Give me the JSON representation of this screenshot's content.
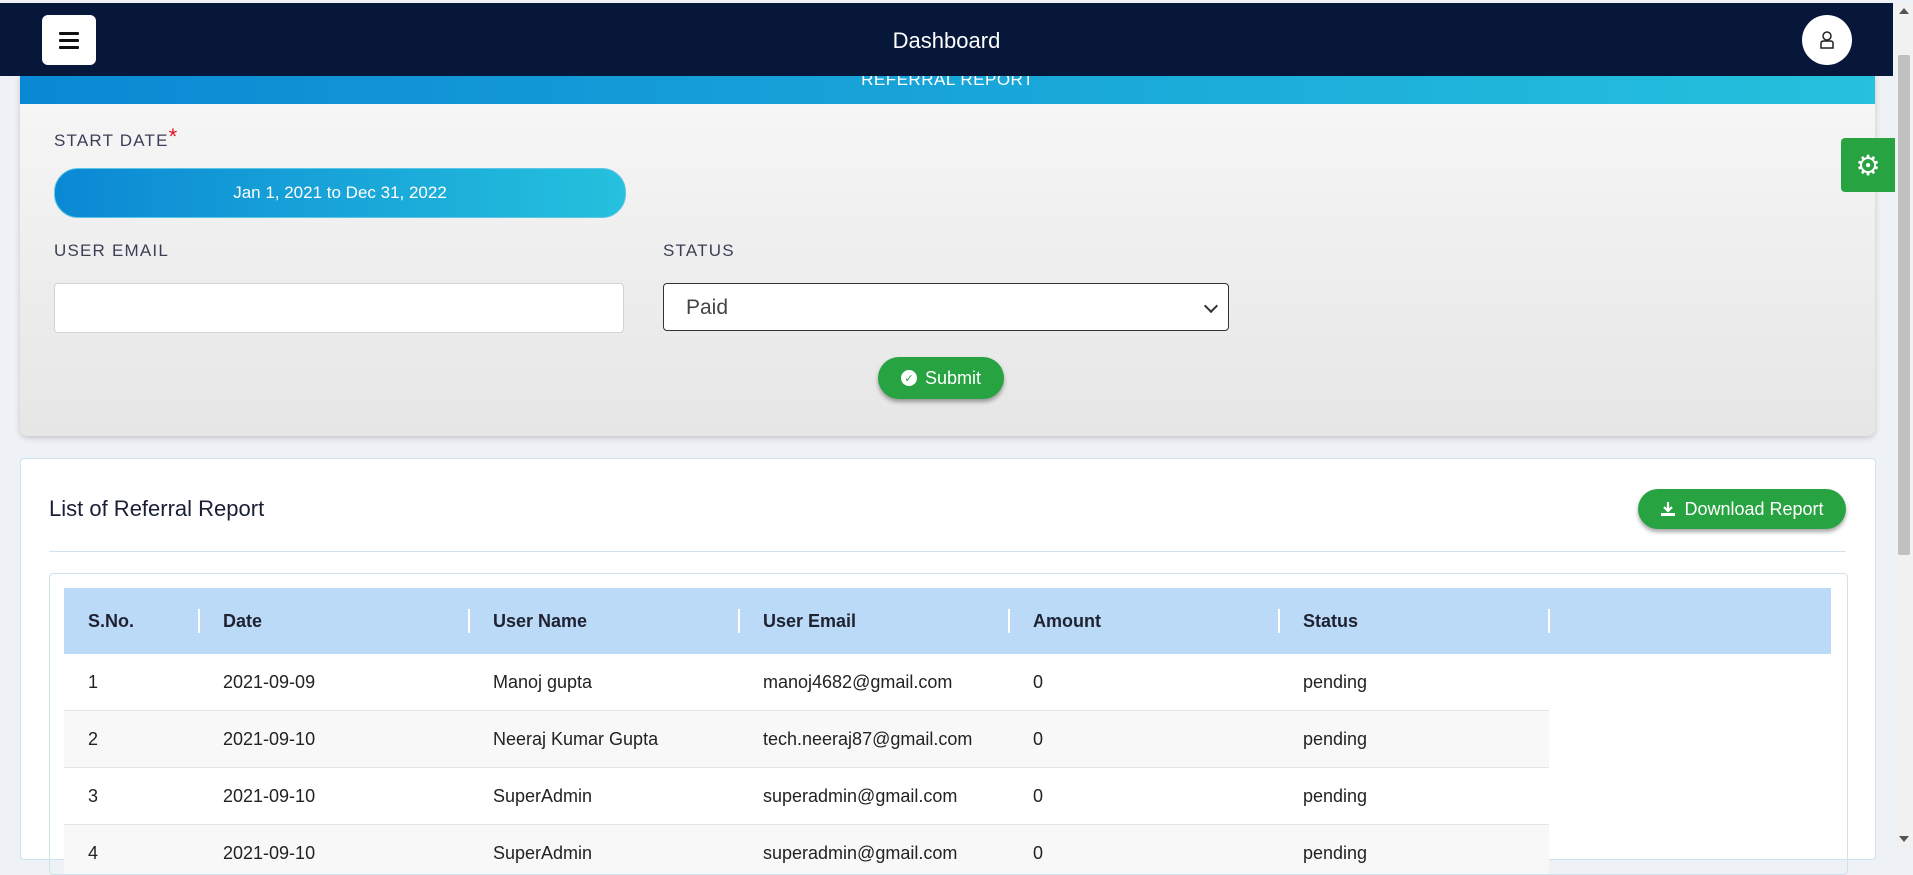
{
  "header": {
    "title": "Dashboard"
  },
  "filter_card": {
    "section_title": "REFERRAL REPORT",
    "start_date_label": "START DATE",
    "required_mark": "*",
    "date_range_value": "Jan 1, 2021 to Dec 31, 2022",
    "user_email_label": "USER EMAIL",
    "user_email_value": "",
    "status_label": "STATUS",
    "status_selected": "Paid",
    "submit_label": "Submit"
  },
  "list_card": {
    "title": "List of Referral Report",
    "download_label": "Download Report",
    "columns": [
      "S.No.",
      "Date",
      "User Name",
      "User Email",
      "Amount",
      "Status"
    ],
    "rows": [
      [
        "1",
        "2021-09-09",
        "Manoj gupta",
        "manoj4682@gmail.com",
        "0",
        "pending"
      ],
      [
        "2",
        "2021-09-10",
        "Neeraj Kumar Gupta",
        "tech.neeraj87@gmail.com",
        "0",
        "pending"
      ],
      [
        "3",
        "2021-09-10",
        "SuperAdmin",
        "superadmin@gmail.com",
        "0",
        "pending"
      ],
      [
        "4",
        "2021-09-10",
        "SuperAdmin",
        "superadmin@gmail.com",
        "0",
        "pending"
      ]
    ]
  },
  "icons": {
    "menu": "hamburger-icon",
    "user": "user-icon",
    "settings": "gear-icon",
    "submit": "check-circle-icon",
    "download": "download-icon"
  },
  "colors": {
    "topbar": "#06173a",
    "accent_gradient_start": "#0b88d4",
    "accent_gradient_end": "#25c1dd",
    "success": "#27a342",
    "table_header": "#badaf8",
    "required": "#e0101f"
  }
}
